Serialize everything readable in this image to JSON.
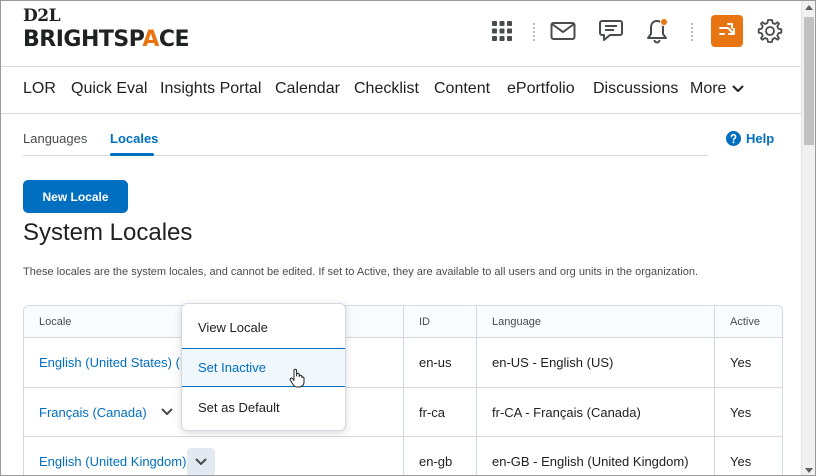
{
  "logo": {
    "top": "D2L",
    "bottom_pre": "BRIGHTSP",
    "bottom_accent": "A",
    "bottom_post": "CE"
  },
  "header_icons": [
    "grid-icon",
    "mail-icon",
    "chat-icon",
    "bell-icon",
    "switch-role-icon",
    "gear-icon"
  ],
  "colors": {
    "accent": "#e87511",
    "link": "#006fbf",
    "text": "#202122"
  },
  "nav": {
    "items": [
      "LOR",
      "Quick Eval",
      "Insights Portal",
      "Calendar",
      "Checklist",
      "Content",
      "ePortfolio",
      "Discussions"
    ],
    "more": "More"
  },
  "tabs": {
    "languages": "Languages",
    "locales": "Locales"
  },
  "help": "Help",
  "new_locale": "New Locale",
  "title": "System Locales",
  "description": "These locales are the system locales, and cannot be edited. If set to Active, they are available to all users and org units in the organization.",
  "table": {
    "headers": {
      "locale": "Locale",
      "id": "ID",
      "language": "Language",
      "active": "Active"
    },
    "rows": [
      {
        "locale": "English (United States) (D",
        "id": "en-us",
        "language": "en-US - English (US)",
        "active": "Yes"
      },
      {
        "locale": "Français (Canada)",
        "id": "fr-ca",
        "language": "fr-CA - Français (Canada)",
        "active": "Yes"
      },
      {
        "locale": "English (United Kingdom)",
        "id": "en-gb",
        "language": "en-GB - English (United Kingdom)",
        "active": "Yes"
      }
    ]
  },
  "menu": {
    "view": "View Locale",
    "inactive": "Set Inactive",
    "default": "Set as Default"
  }
}
